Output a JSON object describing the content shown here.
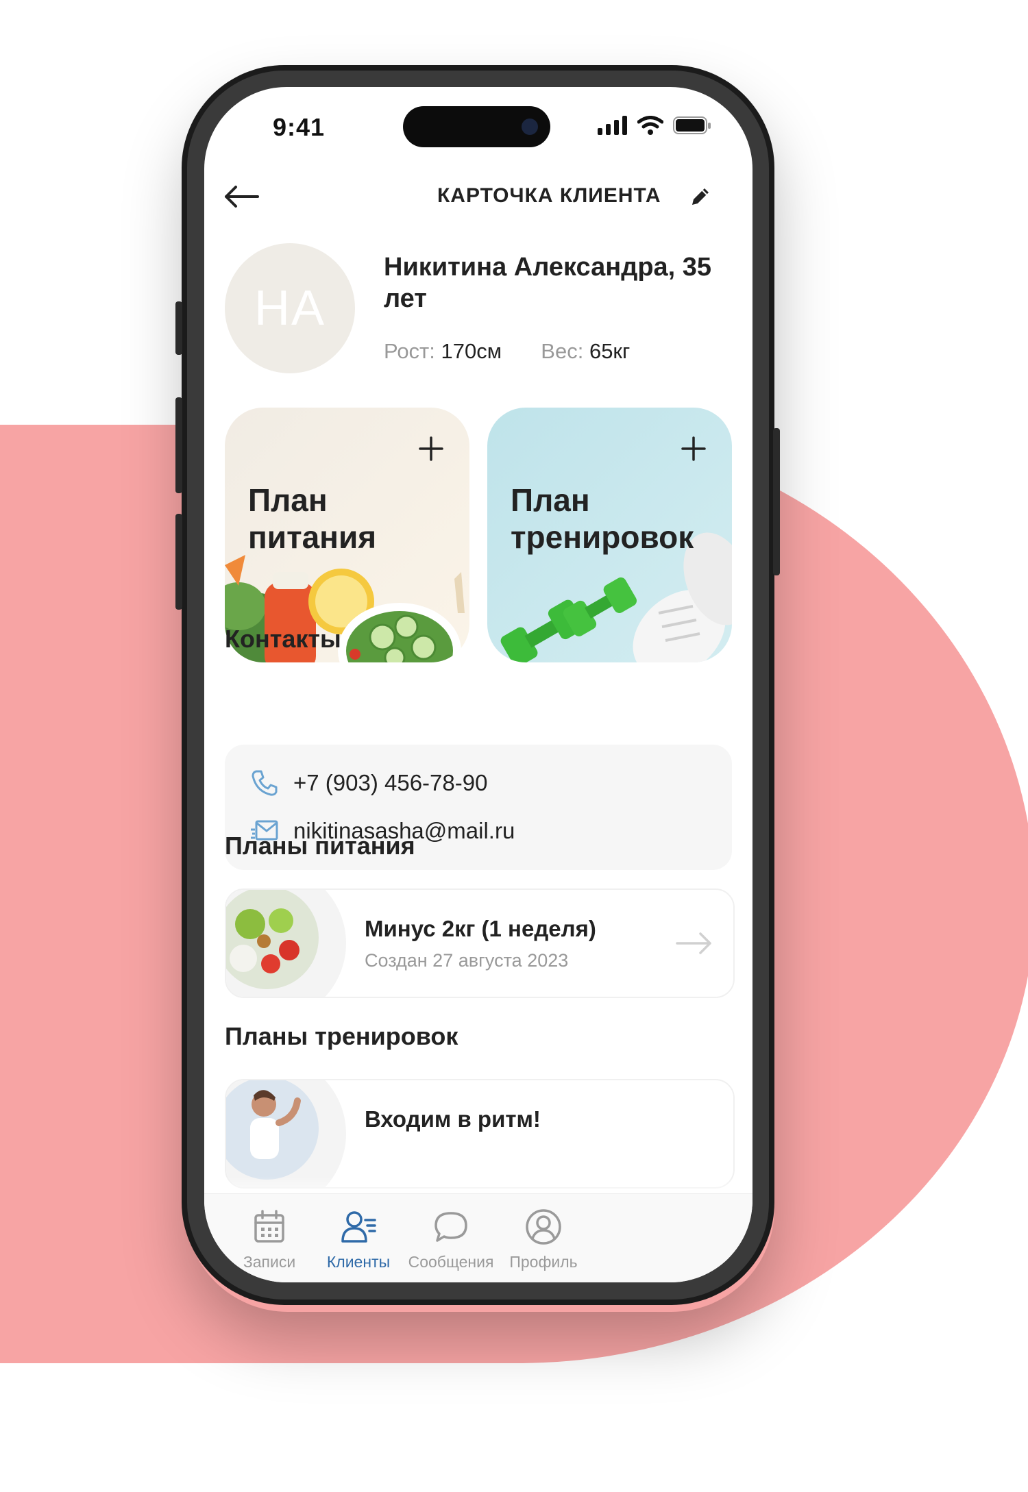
{
  "status_bar": {
    "time": "9:41"
  },
  "header": {
    "title": "КАРТОЧКА КЛИЕНТА"
  },
  "client": {
    "initials": "НА",
    "name": "Никитина Александра, 35 лет",
    "height_label": "Рост:",
    "height_value": "170см",
    "weight_label": "Вес:",
    "weight_value": "65кг"
  },
  "plan_cards": [
    {
      "title": "План\nпитания",
      "bg": "#f5efe6"
    },
    {
      "title": "План\nтренировок",
      "bg": "#c7e6ec"
    }
  ],
  "contacts": {
    "title": "Контакты",
    "phone": "+7 (903) 456-78-90",
    "email": "nikitinasasha@mail.ru"
  },
  "nutrition_plans": {
    "title": "Планы питания",
    "items": [
      {
        "name": "Минус 2кг (1 неделя)",
        "date": "Создан 27 августа 2023"
      }
    ]
  },
  "training_plans": {
    "title": "Планы тренировок",
    "items": [
      {
        "name": "Входим в ритм!"
      }
    ]
  },
  "tabbar": {
    "items": [
      {
        "label": "Записи",
        "icon": "calendar-icon"
      },
      {
        "label": "Клиенты",
        "icon": "clients-icon",
        "active": true
      },
      {
        "label": "Сообщения",
        "icon": "chat-icon"
      },
      {
        "label": "Профиль",
        "icon": "profile-icon"
      }
    ]
  },
  "colors": {
    "accent": "#2f6aa8",
    "background_shape": "#f7a4a4",
    "contact_icon": "#6aa3d1"
  }
}
